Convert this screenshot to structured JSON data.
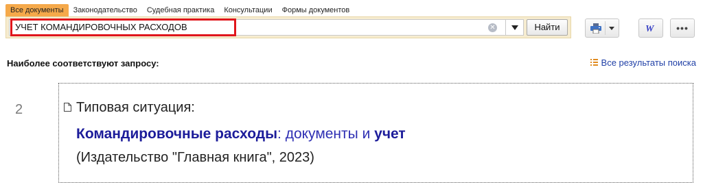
{
  "tabs": [
    {
      "label": "Все документы",
      "active": true
    },
    {
      "label": "Законодательство",
      "active": false
    },
    {
      "label": "Судебная практика",
      "active": false
    },
    {
      "label": "Консультации",
      "active": false
    },
    {
      "label": "Формы документов",
      "active": false
    }
  ],
  "search": {
    "value": "УЧЕТ КОМАНДИРОВОЧНЫХ РАСХОДОВ",
    "find_label": "Найти"
  },
  "toolbar": {
    "icons": [
      "printer-icon",
      "chevron-down-icon",
      "word-icon",
      "more-icon"
    ],
    "word_label": "W",
    "more_label": "•••"
  },
  "section": {
    "title": "Наиболее соответствуют запросу:",
    "all_results_label": "Все результаты поиска"
  },
  "result": {
    "number": "2",
    "line1": "Типовая ситуация:",
    "title_hit1": "Командировочные расходы",
    "title_mid": ": документы и ",
    "title_hit2": "учет",
    "source": "(Издательство \"Главная книга\", 2023)"
  },
  "colors": {
    "active_tab": "#f5a94a",
    "search_bar_bg": "#f6ecd0",
    "highlight_border": "#e0151b",
    "link": "#1f3fa6",
    "hit_text": "#1c1c9a"
  }
}
